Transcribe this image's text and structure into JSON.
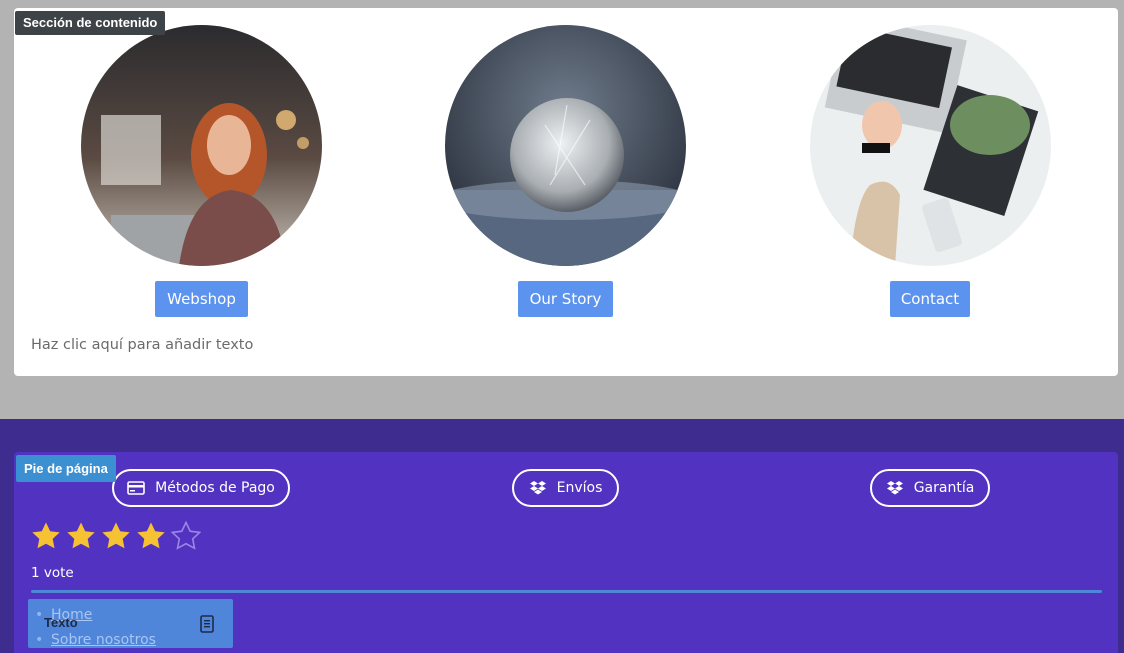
{
  "content_section": {
    "tag": "Sección de contenido",
    "cards": [
      {
        "image": "woman-laptop-cafe-photo",
        "button": "Webshop"
      },
      {
        "image": "frozen-bubble-photo",
        "button": "Our Story"
      },
      {
        "image": "desk-laptop-phone-photo",
        "button": "Contact"
      }
    ],
    "placeholder": "Haz clic aquí para añadir texto"
  },
  "footer": {
    "tag": "Pie de página",
    "features": [
      {
        "icon": "credit-card-icon",
        "label": "Métodos de Pago"
      },
      {
        "icon": "dropbox-icon",
        "label": "Envíos"
      },
      {
        "icon": "dropbox-icon",
        "label": "Garantía"
      }
    ],
    "rating": {
      "score": 4,
      "max": 5,
      "votes_label": "1 vote"
    },
    "nav": {
      "items": [
        "Home",
        "Sobre nosotros"
      ],
      "widget_label": "Texto"
    }
  },
  "colors": {
    "button_blue": "#5b93ee",
    "footer_purple": "#5233c1",
    "star_gold": "#f6c132"
  }
}
